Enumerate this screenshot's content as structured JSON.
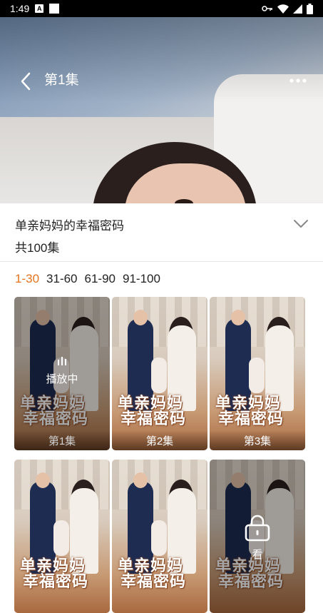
{
  "status_bar": {
    "time": "1:49",
    "a_label": "A"
  },
  "header": {
    "episode_title": "第1集"
  },
  "show": {
    "title": "单亲妈妈的幸福密码",
    "total": "共100集"
  },
  "ranges": [
    "1-30",
    "31-60",
    "61-90",
    "91-100"
  ],
  "poster_text": {
    "line1": "单亲妈妈",
    "line2": "幸福密码"
  },
  "episodes": [
    {
      "label": "第1集",
      "state_text": "播放中"
    },
    {
      "label": "第2集"
    },
    {
      "label": "第3集"
    },
    {
      "label": ""
    },
    {
      "label": ""
    },
    {
      "label": "",
      "lock_text": "看"
    }
  ],
  "colors": {
    "accent": "#e5731f"
  }
}
